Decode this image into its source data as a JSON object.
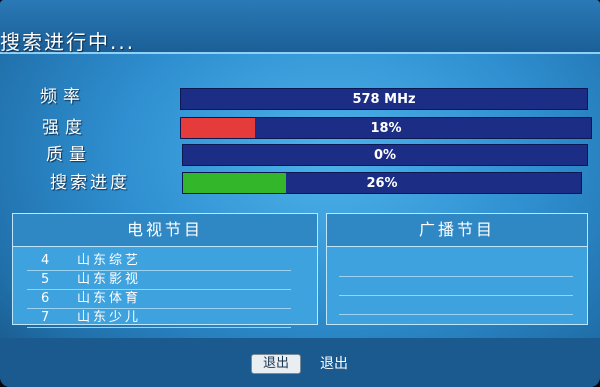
{
  "window": {
    "title": "搜索进行中..."
  },
  "status": {
    "frequency": {
      "label": "频率",
      "value_text": "578 MHz"
    },
    "strength": {
      "label": "强度",
      "value_text": "18%",
      "level_pct": 18,
      "fill_color": "#e63b3b"
    },
    "quality": {
      "label": "质量",
      "value_text": "0%",
      "level_pct": 0
    },
    "search_progress": {
      "label": "搜索进度",
      "value_text": "26%",
      "level_pct": 26,
      "fill_color": "#33b62a"
    }
  },
  "tv_panel": {
    "header": "电视节目",
    "items": [
      {
        "num": "4",
        "name": "山东综艺"
      },
      {
        "num": "5",
        "name": "山东影视"
      },
      {
        "num": "6",
        "name": "山东体育"
      },
      {
        "num": "7",
        "name": "山东少儿"
      }
    ]
  },
  "radio_panel": {
    "header": "广播节目"
  },
  "footer": {
    "exit_key": "退出",
    "exit_label": "退出"
  },
  "colors": {
    "bar_bg": "#1c2d86",
    "panel": "#3ea2de",
    "title_bar": "#1b5f97"
  }
}
